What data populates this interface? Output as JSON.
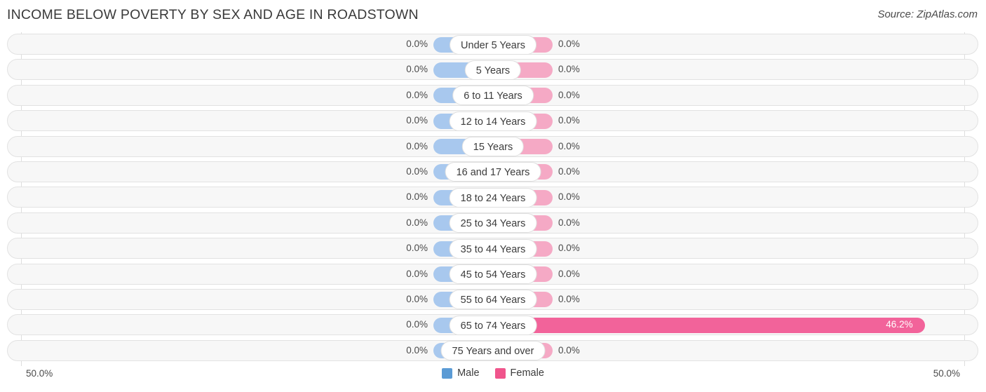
{
  "header": {
    "title": "INCOME BELOW POVERTY BY SEX AND AGE IN ROADSTOWN",
    "source": "Source: ZipAtlas.com"
  },
  "axis": {
    "left_label": "50.0%",
    "right_label": "50.0%",
    "max": 50.0
  },
  "legend": {
    "items": [
      {
        "label": "Male",
        "color": "#5b9bd5"
      },
      {
        "label": "Female",
        "color": "#f0558c"
      }
    ]
  },
  "colors": {
    "male_bar": "#a8c8ee",
    "female_bar": "#f5a9c5",
    "female_bar_highlight": "#f2639a",
    "track": "#f7f7f7",
    "track_border": "#e2e2e2",
    "pill": "#ffffff"
  },
  "chart_data": {
    "type": "bar",
    "orientation": "horizontal",
    "layout": "diverging-pyramid",
    "title": "INCOME BELOW POVERTY BY SEX AND AGE IN ROADSTOWN",
    "xlabel": "",
    "ylabel": "",
    "xlim": [
      -50.0,
      50.0
    ],
    "grid": false,
    "legend_position": "bottom-center",
    "categories": [
      "Under 5 Years",
      "5 Years",
      "6 to 11 Years",
      "12 to 14 Years",
      "15 Years",
      "16 and 17 Years",
      "18 to 24 Years",
      "25 to 34 Years",
      "35 to 44 Years",
      "45 to 54 Years",
      "55 to 64 Years",
      "65 to 74 Years",
      "75 Years and over"
    ],
    "series": [
      {
        "name": "Male",
        "values": [
          0.0,
          0.0,
          0.0,
          0.0,
          0.0,
          0.0,
          0.0,
          0.0,
          0.0,
          0.0,
          0.0,
          0.0,
          0.0
        ],
        "labels": [
          "0.0%",
          "0.0%",
          "0.0%",
          "0.0%",
          "0.0%",
          "0.0%",
          "0.0%",
          "0.0%",
          "0.0%",
          "0.0%",
          "0.0%",
          "0.0%",
          "0.0%"
        ]
      },
      {
        "name": "Female",
        "values": [
          0.0,
          0.0,
          0.0,
          0.0,
          0.0,
          0.0,
          0.0,
          0.0,
          0.0,
          0.0,
          0.0,
          46.2,
          0.0
        ],
        "labels": [
          "0.0%",
          "0.0%",
          "0.0%",
          "0.0%",
          "0.0%",
          "0.0%",
          "0.0%",
          "0.0%",
          "0.0%",
          "0.0%",
          "0.0%",
          "46.2%",
          "0.0%"
        ]
      }
    ]
  }
}
